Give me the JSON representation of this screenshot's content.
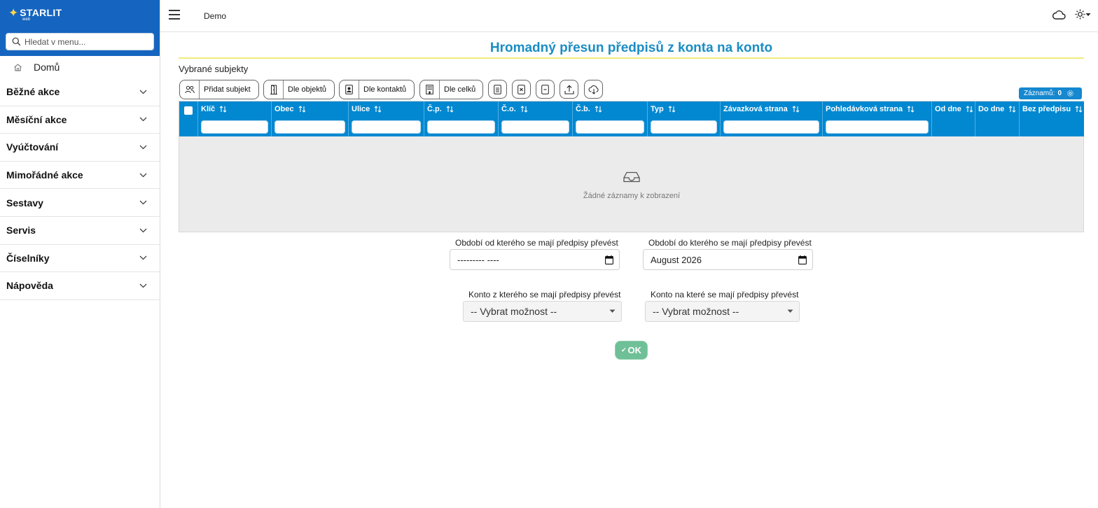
{
  "brand": {
    "name": "STARLIT",
    "sub": "web",
    "star_color": "#ffd54f",
    "header_color": "#1565c0"
  },
  "sidebar": {
    "search_placeholder": "Hledat v menu...",
    "home_label": "Domů",
    "items": [
      {
        "label": "Běžné akce"
      },
      {
        "label": "Měsíční akce"
      },
      {
        "label": "Vyúčtování"
      },
      {
        "label": "Mimořádné akce"
      },
      {
        "label": "Sestavy"
      },
      {
        "label": "Servis"
      },
      {
        "label": "Číselníky"
      },
      {
        "label": "Nápověda"
      }
    ]
  },
  "topbar": {
    "breadcrumb": "Demo"
  },
  "page": {
    "title": "Hromadný přesun předpisů z konta na konto",
    "title_color": "#1a8dc4",
    "section_label": "Vybrané subjekty"
  },
  "toolbar": {
    "add_subject": "Přidat subjekt",
    "by_objects": "Dle objektů",
    "by_contacts": "Dle kontaktů",
    "by_units": "Dle celků"
  },
  "records": {
    "label": "Záznamů:",
    "count": "0"
  },
  "grid": {
    "header_color": "#0288d1",
    "columns": [
      {
        "label": "Klíč"
      },
      {
        "label": "Obec"
      },
      {
        "label": "Ulice"
      },
      {
        "label": "Č.p."
      },
      {
        "label": "Č.o."
      },
      {
        "label": "Č.b."
      },
      {
        "label": "Typ"
      },
      {
        "label": "Závazková strana"
      },
      {
        "label": "Pohledávková strana"
      },
      {
        "label": "Od dne"
      },
      {
        "label": "Do dne"
      },
      {
        "label": "Bez předpisu"
      }
    ],
    "empty_text": "Žádné záznamy k zobrazení"
  },
  "form": {
    "period_from_label": "Období od kterého se mají předpisy převést",
    "period_from_value": "--------- ----",
    "period_to_label": "Období do kterého se mají předpisy převést",
    "period_to_value": "August 2026",
    "account_from_label": "Konto z kterého se mají předpisy převést",
    "account_from_value": "-- Vybrat možnost --",
    "account_to_label": "Konto na které se mají předpisy převést",
    "account_to_value": "-- Vybrat možnost --",
    "ok_label": "OK",
    "ok_color": "#6fbf97"
  }
}
